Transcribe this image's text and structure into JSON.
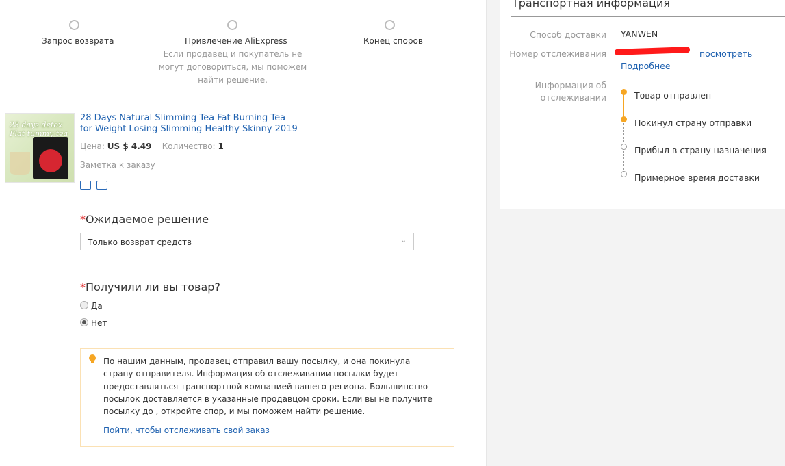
{
  "steps": [
    {
      "label": "Запрос возврата"
    },
    {
      "label": "Привлечение AliExpress",
      "desc": "Если продавец и покупатель не могут договориться, мы поможем найти решение."
    },
    {
      "label": "Конец споров"
    }
  ],
  "product": {
    "image_text": "28 days detox Flat tummy tea",
    "title": "28 Days Natural Slimming Tea Fat Burning Tea for Weight Losing Slimming Healthy Skinny 2019",
    "price_label": "Цена:",
    "price": "US $ 4.49",
    "qty_label": "Количество:",
    "qty": "1",
    "note_placeholder": "Заметка к заказу"
  },
  "solution": {
    "title": "Ожидаемое решение",
    "selected": "Только возврат средств"
  },
  "received": {
    "title": "Получили ли вы товар?",
    "options": [
      {
        "label": "Да",
        "checked": false
      },
      {
        "label": "Нет",
        "checked": true
      }
    ]
  },
  "notice": {
    "text": "По нашим данным, продавец отправил вашу посылку, и она покинула страну отправителя. Информация об отслеживании посылки будет предоставляться транспортной компанией вашего региона. Большинство посылок доставляется в указанные продавцом сроки. Если вы не получите посылку до , откройте спор, и мы поможем найти решение.",
    "link": "Пойти, чтобы отслеживать свой заказ"
  },
  "shipping": {
    "title": "Транспортная информация",
    "method_label": "Способ доставки",
    "method": "YANWEN",
    "tracking_label": "Номер отслеживания",
    "view_link": "посмотреть",
    "more_link": "Подробнее",
    "info_label": "Информация об отслеживании",
    "timeline": [
      {
        "label": "Товар отправлен",
        "done": true
      },
      {
        "label": "Покинул страну отправки",
        "done": true
      },
      {
        "label": "Прибыл в страну назначения",
        "done": false
      },
      {
        "label": "Примерное время доставки",
        "done": false
      }
    ],
    "colors": {
      "done": "#f6a623",
      "pending": "#999999"
    }
  }
}
